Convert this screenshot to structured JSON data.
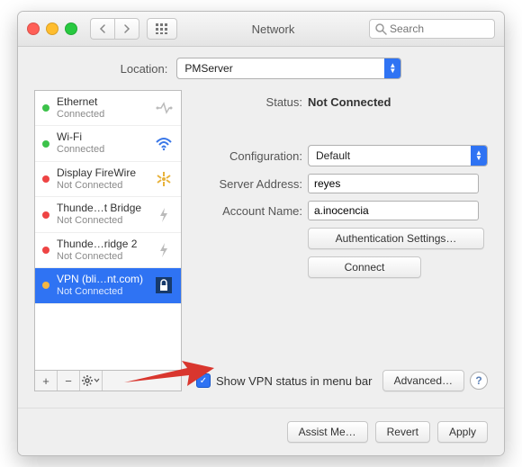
{
  "window": {
    "title": "Network"
  },
  "search": {
    "placeholder": "Search"
  },
  "location": {
    "label": "Location:",
    "value": "PMServer"
  },
  "sidebar": {
    "items": [
      {
        "name": "Ethernet",
        "sub": "Connected",
        "dot": "green"
      },
      {
        "name": "Wi-Fi",
        "sub": "Connected",
        "dot": "green"
      },
      {
        "name": "Display FireWire",
        "sub": "Not Connected",
        "dot": "red"
      },
      {
        "name": "Thunde…t Bridge",
        "sub": "Not Connected",
        "dot": "red"
      },
      {
        "name": "Thunde…ridge 2",
        "sub": "Not Connected",
        "dot": "red"
      },
      {
        "name": "VPN (bli…nt.com)",
        "sub": "Not Connected",
        "dot": "amber"
      }
    ]
  },
  "detail": {
    "status_label": "Status:",
    "status_value": "Not Connected",
    "config_label": "Configuration:",
    "config_value": "Default",
    "server_label": "Server Address:",
    "server_value": "reyes",
    "account_label": "Account Name:",
    "account_value": "a.inocencia",
    "auth_btn": "Authentication Settings…",
    "connect_btn": "Connect",
    "show_status_label": "Show VPN status in menu bar",
    "advanced_btn": "Advanced…"
  },
  "footer": {
    "assist": "Assist Me…",
    "revert": "Revert",
    "apply": "Apply"
  }
}
